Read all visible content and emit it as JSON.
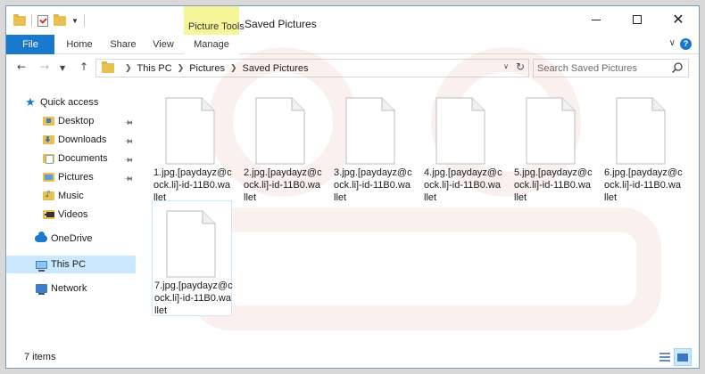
{
  "window": {
    "title": "Saved Pictures",
    "context_tab_group": "Picture Tools"
  },
  "ribbon": {
    "tabs": [
      {
        "label": "File"
      },
      {
        "label": "Home"
      },
      {
        "label": "Share"
      },
      {
        "label": "View"
      },
      {
        "label": "Manage"
      }
    ]
  },
  "address": {
    "breadcrumbs": [
      "This PC",
      "Pictures",
      "Saved Pictures"
    ],
    "search_placeholder": "Search Saved Pictures"
  },
  "nav_pane": {
    "quick_access": "Quick access",
    "quick_items": [
      {
        "label": "Desktop",
        "icon": "desktop-folder-icon",
        "pinned": true
      },
      {
        "label": "Downloads",
        "icon": "downloads-folder-icon",
        "pinned": true
      },
      {
        "label": "Documents",
        "icon": "documents-folder-icon",
        "pinned": true
      },
      {
        "label": "Pictures",
        "icon": "pictures-folder-icon",
        "pinned": true
      },
      {
        "label": "Music",
        "icon": "music-folder-icon",
        "pinned": false
      },
      {
        "label": "Videos",
        "icon": "videos-folder-icon",
        "pinned": false
      }
    ],
    "onedrive": "OneDrive",
    "this_pc": "This PC",
    "network": "Network"
  },
  "files": [
    {
      "name": "1.jpg.[paydayz@cock.li]-id-11B0.wallet"
    },
    {
      "name": "2.jpg.[paydayz@cock.li]-id-11B0.wallet"
    },
    {
      "name": "3.jpg.[paydayz@cock.li]-id-11B0.wallet"
    },
    {
      "name": "4.jpg.[paydayz@cock.li]-id-11B0.wallet"
    },
    {
      "name": "5.jpg.[paydayz@cock.li]-id-11B0.wallet"
    },
    {
      "name": "6.jpg.[paydayz@cock.li]-id-11B0.wallet"
    },
    {
      "name": "7.jpg.[paydayz@cock.li]-id-11B0.wallet"
    }
  ],
  "status": {
    "item_count": "7 items"
  },
  "colors": {
    "accent": "#1979ca",
    "context_tab": "#f5f59a",
    "selection": "#cce8ff"
  }
}
